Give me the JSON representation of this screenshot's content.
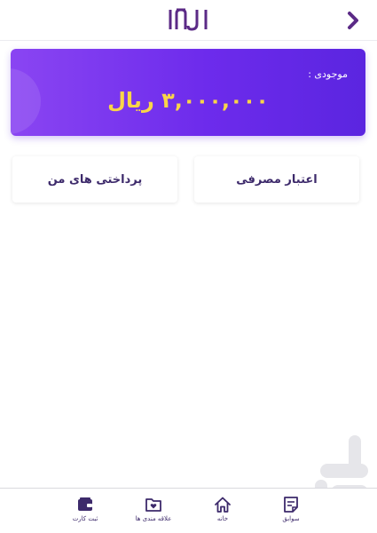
{
  "header": {
    "logo_text": "IAJI",
    "back_icon": "chevron-right-icon",
    "accent_color": "#5b2a86"
  },
  "balance": {
    "label": "موجودی :",
    "amount": "۳,۰۰۰,۰۰۰ ریال",
    "gradient_start": "#8a45f2",
    "gradient_end": "#5b25e0",
    "amount_color": "#f9d548"
  },
  "actions": {
    "credit_label": "اعتبار مصرفی",
    "payments_label": "پرداختی های من"
  },
  "nav": {
    "items": [
      {
        "label": "سوابق",
        "icon": "records-icon"
      },
      {
        "label": "خانه",
        "icon": "home-icon"
      },
      {
        "label": "علاقه مندی ها",
        "icon": "favorites-folder-icon"
      },
      {
        "label": "ثبت کارت",
        "icon": "wallet-icon"
      }
    ]
  }
}
